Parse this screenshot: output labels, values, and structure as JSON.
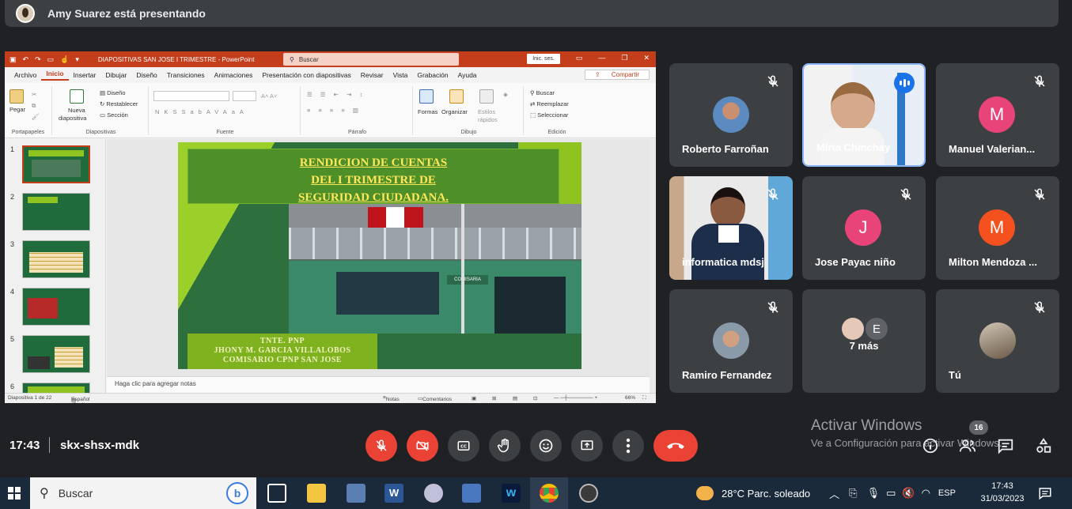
{
  "banner": {
    "text": "Amy Suarez está presentando"
  },
  "ppt": {
    "doc_title": "DIAPOSITIVAS SAN JOSE I TRIMESTRE",
    "app": "PowerPoint",
    "title_sep": "-",
    "search": "Buscar",
    "login": "Inic. ses.",
    "menu": [
      "Archivo",
      "Inicio",
      "Insertar",
      "Dibujar",
      "Diseño",
      "Transiciones",
      "Animaciones",
      "Presentación con diapositivas",
      "Revisar",
      "Vista",
      "Grabación",
      "Ayuda"
    ],
    "active_menu": "Inicio",
    "share": "Compartir",
    "ribbon": {
      "portapapeles": "Portapapeles",
      "pegar": "Pegar",
      "nueva": "Nueva",
      "diapositiva": "diapositiva",
      "diseno": "Diseño",
      "restablecer": "Restablecer",
      "seccion": "Sección",
      "diapositivas": "Diapositivas",
      "fuente": "Fuente",
      "parrafo": "Párrafo",
      "formas": "Formas",
      "organizar": "Organizar",
      "estilos": "Estilos",
      "rapidos": "rápidos",
      "dibujo": "Dibujo",
      "buscar": "Buscar",
      "reemplazar": "Reemplazar",
      "seleccionar": "Seleccionar",
      "edicion": "Edición",
      "format_letters": [
        "N",
        "K",
        "S",
        "S",
        "ab",
        "AV",
        "Aa",
        "A"
      ]
    },
    "thumb_numbers": [
      "1",
      "2",
      "3",
      "4",
      "5",
      "6"
    ],
    "slide": {
      "title_lines": [
        "RENDICION DE CUENTAS",
        "DEL I TRIMESTRE DE",
        "SEGURIDAD CIUDADANA."
      ],
      "caption_lines": [
        "TNTE. PNP",
        "JHONY M. GARCIA VILLALOBOS",
        "COMISARIO CPNP SAN JOSE"
      ],
      "sign": "COMISARIA"
    },
    "notes": "Haga clic para agregar notas",
    "status": {
      "slide": "Diapositiva 1 de 22",
      "lang": "Español (Perú)",
      "notas": "Notas",
      "comentarios": "Comentarios",
      "zoom": "66%"
    }
  },
  "participants": [
    {
      "name": "Roberto Farroñan",
      "type": "photo"
    },
    {
      "name": "Mirta Chinchay",
      "type": "video",
      "speaking": true
    },
    {
      "name": "Manuel Valerian...",
      "type": "letter",
      "letter": "M",
      "color": "#e8447a"
    },
    {
      "name": "informatica mdsj",
      "type": "video"
    },
    {
      "name": "Jose Payac niño",
      "type": "letter",
      "letter": "J",
      "color": "#e8447a"
    },
    {
      "name": "Milton Mendoza ...",
      "type": "letter",
      "letter": "M",
      "color": "#f4511e"
    },
    {
      "name": "Ramiro Fernandez",
      "type": "photo"
    },
    {
      "name": "7 más",
      "type": "more",
      "letter": "E"
    },
    {
      "name": "Tú",
      "type": "photo"
    }
  ],
  "meeting": {
    "time": "17:43",
    "code": "skx-shsx-mdk"
  },
  "activation": {
    "line1": "Activar Windows",
    "line2": "Ve a Configuración para activar Windows."
  },
  "people_count": "16",
  "taskbar": {
    "search": "Buscar",
    "weather": "28°C  Parc. soleado",
    "lang": "ESP",
    "time": "17:43",
    "date": "31/03/2023"
  },
  "colors": {
    "ppt_accent": "#c43e1c",
    "meet_red": "#ea4335",
    "tile_bg": "#3c4043"
  }
}
